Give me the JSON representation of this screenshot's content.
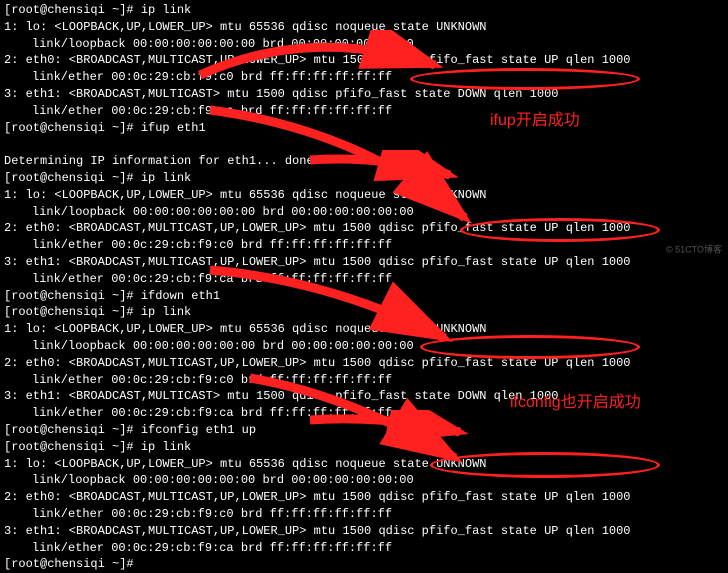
{
  "prompt": "[root@chensiqi ~]#",
  "commands": {
    "ip_link": "ip link",
    "ifup_eth1": "ifup eth1",
    "ifdown_eth1": "ifdown eth1",
    "ifconfig_eth1_up": "ifconfig eth1 up",
    "empty": ""
  },
  "output": {
    "lo_flags": "1: lo: <LOOPBACK,UP,LOWER_UP> mtu 65536 qdisc noqueue state UNKNOWN",
    "lo_link": "link/loopback 00:00:00:00:00:00 brd 00:00:00:00:00:00",
    "eth0_flags": "2: eth0: <BROADCAST,MULTICAST,UP,LOWER_UP> mtu 1500 qdisc pfifo_fast state UP qlen 1000",
    "eth0_link": "link/ether 00:0c:29:cb:f9:c0 brd ff:ff:ff:ff:ff:ff",
    "eth1_down": "3: eth1: <BROADCAST,MULTICAST> mtu 1500 qdisc pfifo_fast state DOWN qlen 1000",
    "eth1_up": "3: eth1: <BROADCAST,MULTICAST,UP,LOWER_UP> mtu 1500 qdisc pfifo_fast state UP qlen 1000",
    "eth1_link": "link/ether 00:0c:29:cb:f9:ca brd ff:ff:ff:ff:ff:ff",
    "determining": "Determining IP information for eth1... done."
  },
  "annotations": {
    "ifup_success": "ifup开启成功",
    "ifconfig_success": "ifconfig也开启成功"
  },
  "watermark": "© 51CTO博客"
}
